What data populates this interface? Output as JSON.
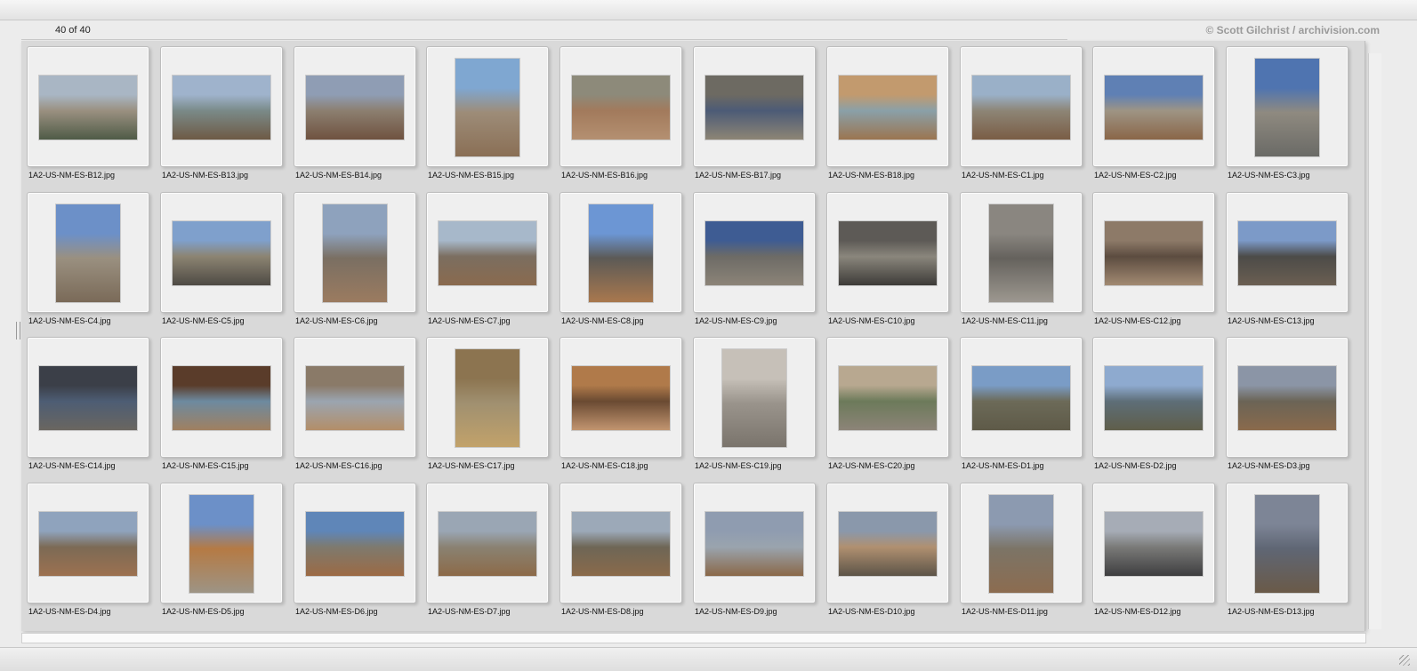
{
  "toolbar": {
    "count_text": "40 of 40"
  },
  "copyright": "© Scott Gilchrist / archivision.com",
  "images": [
    {
      "file": "1A2-US-NM-ES-B12.jpg",
      "orientation": "landscape",
      "colors": [
        "#a9b6c4",
        "#9a9080",
        "#4f5b47"
      ]
    },
    {
      "file": "1A2-US-NM-ES-B13.jpg",
      "orientation": "landscape",
      "colors": [
        "#9fb3cc",
        "#7a8a88",
        "#6e5a45"
      ]
    },
    {
      "file": "1A2-US-NM-ES-B14.jpg",
      "orientation": "landscape",
      "colors": [
        "#8f9db4",
        "#8c7f70",
        "#6f5240"
      ]
    },
    {
      "file": "1A2-US-NM-ES-B15.jpg",
      "orientation": "portrait",
      "colors": [
        "#7fa7d1",
        "#9d8c78",
        "#8a6f55"
      ]
    },
    {
      "file": "1A2-US-NM-ES-B16.jpg",
      "orientation": "landscape",
      "colors": [
        "#8d8a7a",
        "#a27a5c",
        "#b49071"
      ]
    },
    {
      "file": "1A2-US-NM-ES-B17.jpg",
      "orientation": "landscape",
      "colors": [
        "#6d6a62",
        "#4c5b76",
        "#8d8575"
      ]
    },
    {
      "file": "1A2-US-NM-ES-B18.jpg",
      "orientation": "landscape",
      "colors": [
        "#c29a6e",
        "#8aa0a8",
        "#9b7550"
      ]
    },
    {
      "file": "1A2-US-NM-ES-C1.jpg",
      "orientation": "landscape",
      "colors": [
        "#9ab0c8",
        "#8d8576",
        "#7a5d45"
      ]
    },
    {
      "file": "1A2-US-NM-ES-C2.jpg",
      "orientation": "landscape",
      "colors": [
        "#5f80b4",
        "#9e9484",
        "#8a6648"
      ]
    },
    {
      "file": "1A2-US-NM-ES-C3.jpg",
      "orientation": "portrait",
      "colors": [
        "#4f74b0",
        "#8f8a80",
        "#6a6a66"
      ]
    },
    {
      "file": "1A2-US-NM-ES-C4.jpg",
      "orientation": "portrait",
      "colors": [
        "#6c90c8",
        "#9a9080",
        "#7a6a58"
      ]
    },
    {
      "file": "1A2-US-NM-ES-C5.jpg",
      "orientation": "landscape",
      "colors": [
        "#7fa0cc",
        "#8c8472",
        "#4e4a44"
      ]
    },
    {
      "file": "1A2-US-NM-ES-C6.jpg",
      "orientation": "portrait",
      "colors": [
        "#8ea2bd",
        "#7a6f62",
        "#9b7b60"
      ]
    },
    {
      "file": "1A2-US-NM-ES-C7.jpg",
      "orientation": "landscape",
      "colors": [
        "#a7b8ca",
        "#7b6e60",
        "#8a6a4e"
      ]
    },
    {
      "file": "1A2-US-NM-ES-C8.jpg",
      "orientation": "portrait",
      "colors": [
        "#6c96d4",
        "#5c5a56",
        "#a9784e"
      ]
    },
    {
      "file": "1A2-US-NM-ES-C9.jpg",
      "orientation": "landscape",
      "colors": [
        "#3e5c93",
        "#6d6b66",
        "#8c8478"
      ]
    },
    {
      "file": "1A2-US-NM-ES-C10.jpg",
      "orientation": "landscape",
      "colors": [
        "#5d5a56",
        "#8a867c",
        "#3d3b38"
      ]
    },
    {
      "file": "1A2-US-NM-ES-C11.jpg",
      "orientation": "portrait",
      "colors": [
        "#8a8680",
        "#65625d",
        "#9d9890"
      ]
    },
    {
      "file": "1A2-US-NM-ES-C12.jpg",
      "orientation": "landscape",
      "colors": [
        "#8d7a68",
        "#5c4c40",
        "#a28a72"
      ]
    },
    {
      "file": "1A2-US-NM-ES-C13.jpg",
      "orientation": "landscape",
      "colors": [
        "#7c9ac8",
        "#4c4b48",
        "#6b5f52"
      ]
    },
    {
      "file": "1A2-US-NM-ES-C14.jpg",
      "orientation": "landscape",
      "colors": [
        "#3b3f48",
        "#4d5d74",
        "#6a6660"
      ]
    },
    {
      "file": "1A2-US-NM-ES-C15.jpg",
      "orientation": "landscape",
      "colors": [
        "#5a3c2a",
        "#6d8aa0",
        "#a08060"
      ]
    },
    {
      "file": "1A2-US-NM-ES-C16.jpg",
      "orientation": "landscape",
      "colors": [
        "#8a7a68",
        "#9ba5b0",
        "#b38e68"
      ]
    },
    {
      "file": "1A2-US-NM-ES-C17.jpg",
      "orientation": "portrait",
      "colors": [
        "#8c7450",
        "#a09070",
        "#c2a26a"
      ]
    },
    {
      "file": "1A2-US-NM-ES-C18.jpg",
      "orientation": "landscape",
      "colors": [
        "#b07a4a",
        "#6a4a32",
        "#c29570"
      ]
    },
    {
      "file": "1A2-US-NM-ES-C19.jpg",
      "orientation": "portrait",
      "colors": [
        "#c6c0b8",
        "#9a948c",
        "#7a746c"
      ]
    },
    {
      "file": "1A2-US-NM-ES-C20.jpg",
      "orientation": "landscape",
      "colors": [
        "#b8a890",
        "#6c7a5a",
        "#8c8478"
      ]
    },
    {
      "file": "1A2-US-NM-ES-D1.jpg",
      "orientation": "landscape",
      "colors": [
        "#7a9cc6",
        "#6c6a58",
        "#5e5a48"
      ]
    },
    {
      "file": "1A2-US-NM-ES-D2.jpg",
      "orientation": "landscape",
      "colors": [
        "#8eaacf",
        "#5e6e78",
        "#5f5e4a"
      ]
    },
    {
      "file": "1A2-US-NM-ES-D3.jpg",
      "orientation": "landscape",
      "colors": [
        "#8b95a6",
        "#6b6456",
        "#8a6a4c"
      ]
    },
    {
      "file": "1A2-US-NM-ES-D4.jpg",
      "orientation": "landscape",
      "colors": [
        "#8fa3bd",
        "#7c6a55",
        "#9c7150"
      ]
    },
    {
      "file": "1A2-US-NM-ES-D5.jpg",
      "orientation": "portrait",
      "colors": [
        "#6c90c8",
        "#b57a44",
        "#9d9485"
      ]
    },
    {
      "file": "1A2-US-NM-ES-D6.jpg",
      "orientation": "landscape",
      "colors": [
        "#5f86b8",
        "#7e7a6e",
        "#9c6a44"
      ]
    },
    {
      "file": "1A2-US-NM-ES-D7.jpg",
      "orientation": "landscape",
      "colors": [
        "#9aa6b4",
        "#8a8272",
        "#8c6a48"
      ]
    },
    {
      "file": "1A2-US-NM-ES-D8.jpg",
      "orientation": "landscape",
      "colors": [
        "#9ca9b8",
        "#6e6656",
        "#8a6a4a"
      ]
    },
    {
      "file": "1A2-US-NM-ES-D9.jpg",
      "orientation": "landscape",
      "colors": [
        "#8f9cb0",
        "#9aa4ae",
        "#8a6848"
      ]
    },
    {
      "file": "1A2-US-NM-ES-D10.jpg",
      "orientation": "landscape",
      "colors": [
        "#8a98ab",
        "#b09070",
        "#5c5448"
      ]
    },
    {
      "file": "1A2-US-NM-ES-D11.jpg",
      "orientation": "portrait",
      "colors": [
        "#8c9ab0",
        "#7c7466",
        "#8c6c50"
      ]
    },
    {
      "file": "1A2-US-NM-ES-D12.jpg",
      "orientation": "landscape",
      "colors": [
        "#a6acb6",
        "#7a7a78",
        "#3e3e40"
      ]
    },
    {
      "file": "1A2-US-NM-ES-D13.jpg",
      "orientation": "portrait",
      "colors": [
        "#7d8596",
        "#5f6674",
        "#6a5a48"
      ]
    }
  ]
}
